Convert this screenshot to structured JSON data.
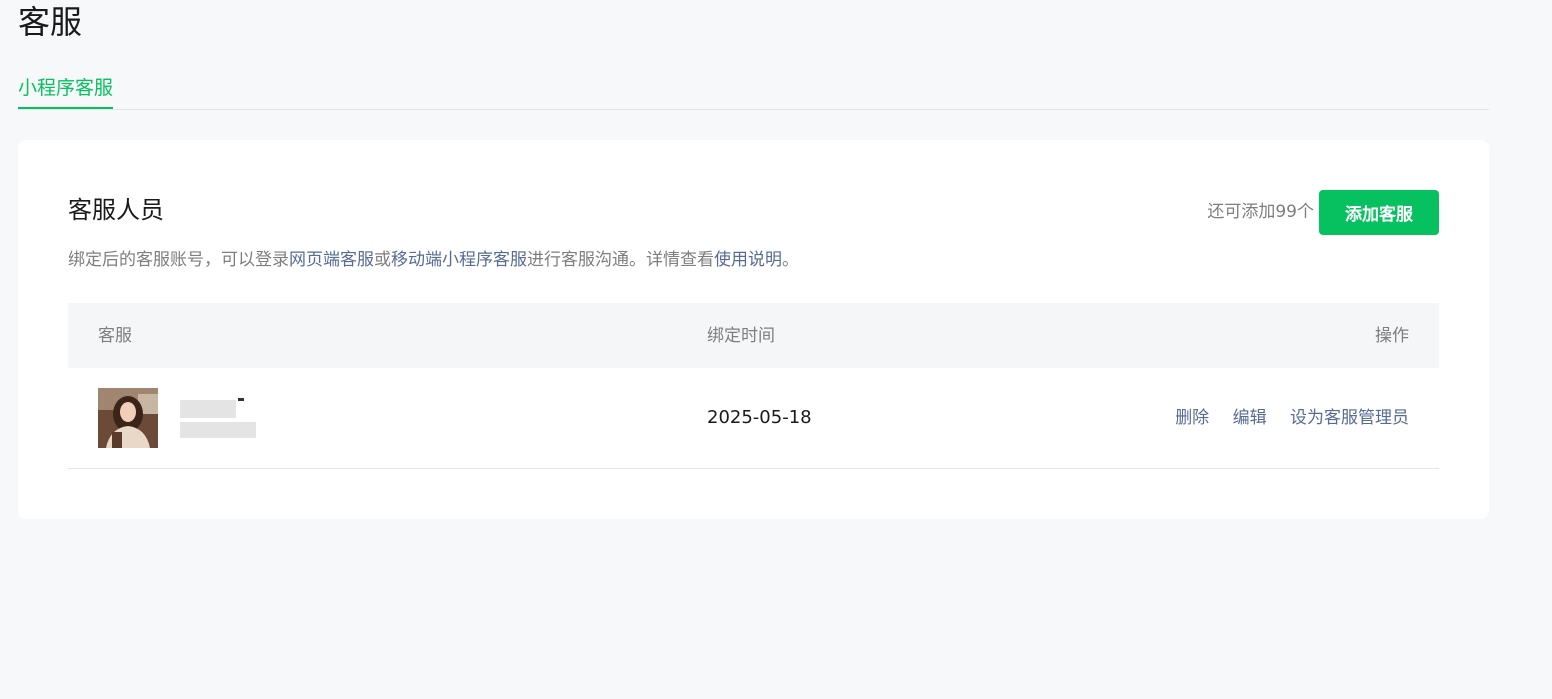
{
  "page": {
    "title": "客服"
  },
  "tabs": [
    {
      "label": "小程序客服",
      "active": true
    }
  ],
  "section": {
    "title": "客服人员",
    "quota_text": "还可添加99个",
    "add_button_label": "添加客服",
    "description": {
      "part1": "绑定后的客服账号，可以登录",
      "link1": "网页端客服",
      "part2": "或",
      "link2": "移动端小程序客服",
      "part3": "进行客服沟通。详情查看",
      "link3": "使用说明",
      "part4": "。"
    }
  },
  "table": {
    "headers": {
      "agent": "客服",
      "bind_time": "绑定时间",
      "actions": "操作"
    },
    "rows": [
      {
        "agent_name": "",
        "bind_time": "2025-05-18",
        "actions": [
          "删除",
          "编辑",
          "设为客服管理员"
        ]
      }
    ]
  },
  "colors": {
    "accent": "#07c160",
    "link": "#576b95",
    "muted_text": "#7e7e7e",
    "page_background": "#f7f8fa",
    "header_background": "#f5f6f7"
  },
  "icons": {
    "avatar": "user-photo-avatar"
  }
}
